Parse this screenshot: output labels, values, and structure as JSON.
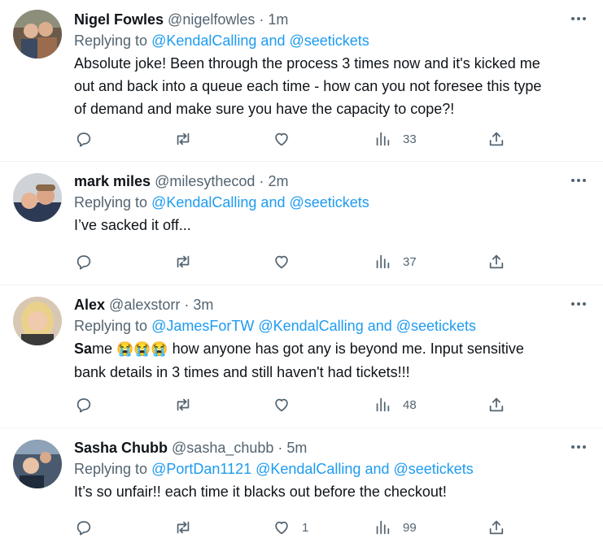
{
  "tweets": [
    {
      "name": "Nigel Fowles",
      "handle": "@nigelfowles",
      "separator": "·",
      "time": "1m",
      "replying_prefix": "Replying to",
      "replying_targets": "@KendalCalling and @seetickets",
      "text_lines": [
        "Absolute joke! Been through the process 3 times now and it's kicked me",
        "out and back into a queue each time - how can you not foresee this type",
        "of demand and make sure you have the capacity to cope?!"
      ],
      "likes": "",
      "views": "33"
    },
    {
      "name": "mark miles",
      "handle": "@milesythecod",
      "separator": "·",
      "time": "2m",
      "replying_prefix": "Replying to",
      "replying_targets": "@KendalCalling and @seetickets",
      "text_lines": [
        "I’ve sacked it off..."
      ],
      "likes": "",
      "views": "37"
    },
    {
      "name": "Alex",
      "handle": "@alexstorr",
      "separator": "·",
      "time": "3m",
      "replying_prefix": "Replying to",
      "replying_targets": "@JamesForTW @KendalCalling and @seetickets",
      "text_bold": "Sa",
      "text_rest": "me",
      "text_emojis": "😭😭😭",
      "text_after_emoji": " how anyone has got any is beyond me. Input sensitive",
      "text_line2": "bank details in 3 times and still haven't had tickets!!!",
      "likes": "",
      "views": "48"
    },
    {
      "name": "Sasha Chubb",
      "handle": "@sasha_chubb",
      "separator": "·",
      "time": "5m",
      "replying_prefix": "Replying to",
      "replying_targets": "@PortDan1121 @KendalCalling and @seetickets",
      "text_lines": [
        "It’s so unfair!! each time it blacks out before the checkout!"
      ],
      "likes": "1",
      "views": "99"
    }
  ],
  "icons": {
    "reply": "reply-icon",
    "retweet": "retweet-icon",
    "like": "heart-icon",
    "views": "views-icon",
    "share": "share-icon",
    "more": "more-icon"
  },
  "colors": {
    "link": "#1d9bf0",
    "secondary": "#536471",
    "text": "#0f1419",
    "divider": "#eff3f4"
  }
}
